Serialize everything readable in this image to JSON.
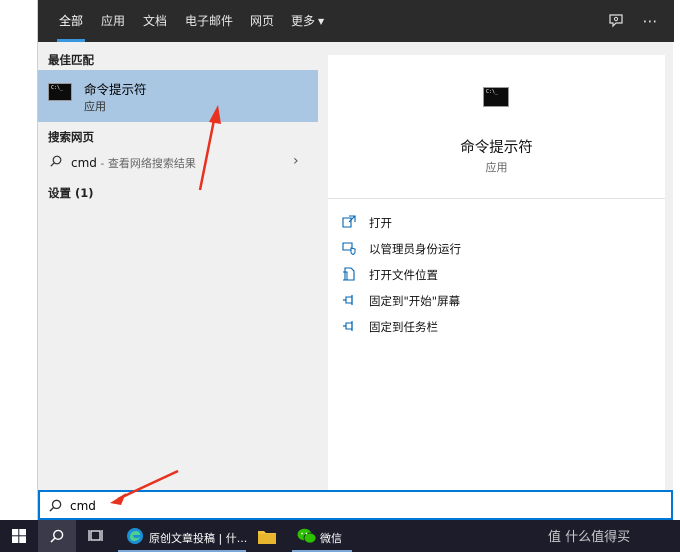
{
  "tabs": [
    {
      "label": "全部",
      "active": true
    },
    {
      "label": "应用"
    },
    {
      "label": "文档"
    },
    {
      "label": "电子邮件"
    },
    {
      "label": "网页"
    },
    {
      "label": "更多"
    }
  ],
  "top_icons": [
    "feedback-icon",
    "more-options-icon"
  ],
  "results": {
    "best_match_heading": "最佳匹配",
    "best_match": {
      "title": "命令提示符",
      "subtitle": "应用",
      "icon": "terminal-icon"
    },
    "web_heading": "搜索网页",
    "web_item": {
      "query": "cmd",
      "suffix": " - 查看网络搜索结果"
    },
    "settings_heading": "设置 (1)"
  },
  "preview": {
    "title": "命令提示符",
    "subtitle": "应用",
    "actions": [
      {
        "label": "打开",
        "icon": "open-icon"
      },
      {
        "label": "以管理员身份运行",
        "icon": "admin-shield-icon"
      },
      {
        "label": "打开文件位置",
        "icon": "file-location-icon"
      },
      {
        "label": "固定到\"开始\"屏幕",
        "icon": "pin-icon"
      },
      {
        "label": "固定到任务栏",
        "icon": "pin-icon"
      }
    ]
  },
  "search": {
    "value": "cmd"
  },
  "taskbar": {
    "edge_label": "原创文章投稿 | 什...",
    "wechat_label": "微信",
    "watermark": "值 什么值得买"
  },
  "colors": {
    "accent": "#0078d7",
    "selection": "#a9c6e2",
    "topbar": "#2b2b2b",
    "taskbar": "#1c1c2a",
    "arrow": "#e8311e"
  }
}
